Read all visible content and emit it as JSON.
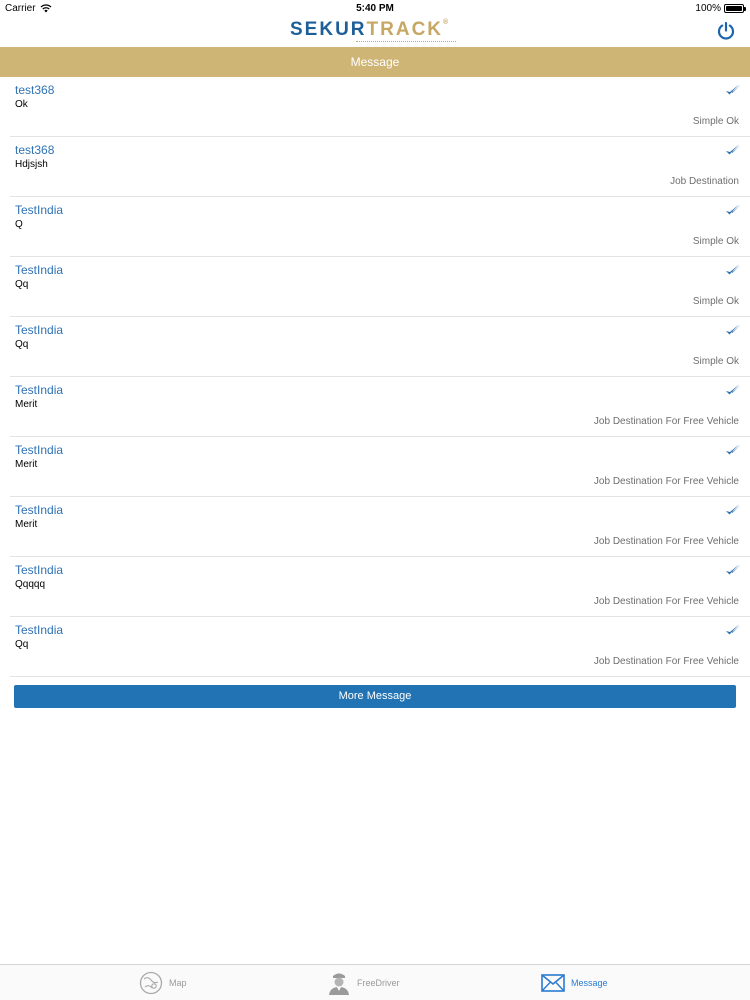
{
  "status_bar": {
    "carrier": "Carrier",
    "time": "5:40 PM",
    "battery": "100%",
    "battery_level": 1.0
  },
  "header": {
    "logo_part1": "SEKUR",
    "logo_part2": "TRACK",
    "logo_reg": "®",
    "power_icon": "power-icon"
  },
  "title_bar": {
    "title": "Message"
  },
  "messages": [
    {
      "sender": "test368",
      "body": "Ok",
      "type": "Simple Ok"
    },
    {
      "sender": "test368",
      "body": "Hdjsjsh",
      "type": "Job Destination"
    },
    {
      "sender": "TestIndia",
      "body": "Q",
      "type": "Simple Ok"
    },
    {
      "sender": "TestIndia",
      "body": "Qq",
      "type": "Simple Ok"
    },
    {
      "sender": "TestIndia",
      "body": "Qq",
      "type": "Simple Ok"
    },
    {
      "sender": "TestIndia",
      "body": "Merit",
      "type": "Job Destination For Free Vehicle"
    },
    {
      "sender": "TestIndia",
      "body": "Merit",
      "type": "Job Destination For Free Vehicle"
    },
    {
      "sender": "TestIndia",
      "body": "Merit",
      "type": "Job Destination For Free Vehicle"
    },
    {
      "sender": "TestIndia",
      "body": "Qqqqq",
      "type": "Job Destination For Free Vehicle"
    },
    {
      "sender": "TestIndia",
      "body": "Qq",
      "type": "Job Destination For Free Vehicle"
    }
  ],
  "more_button": {
    "label": "More Message"
  },
  "tabs": [
    {
      "label": "Map",
      "icon": "map-icon",
      "active": false
    },
    {
      "label": "FreeDriver",
      "icon": "driver-icon",
      "active": false
    },
    {
      "label": "Message",
      "icon": "envelope-icon",
      "active": true
    }
  ],
  "colors": {
    "brand_blue": "#1e5f99",
    "brand_gold": "#c6a763",
    "title_bar": "#cfb575",
    "button_blue": "#2173b4",
    "tab_active": "#2a7bd1"
  }
}
